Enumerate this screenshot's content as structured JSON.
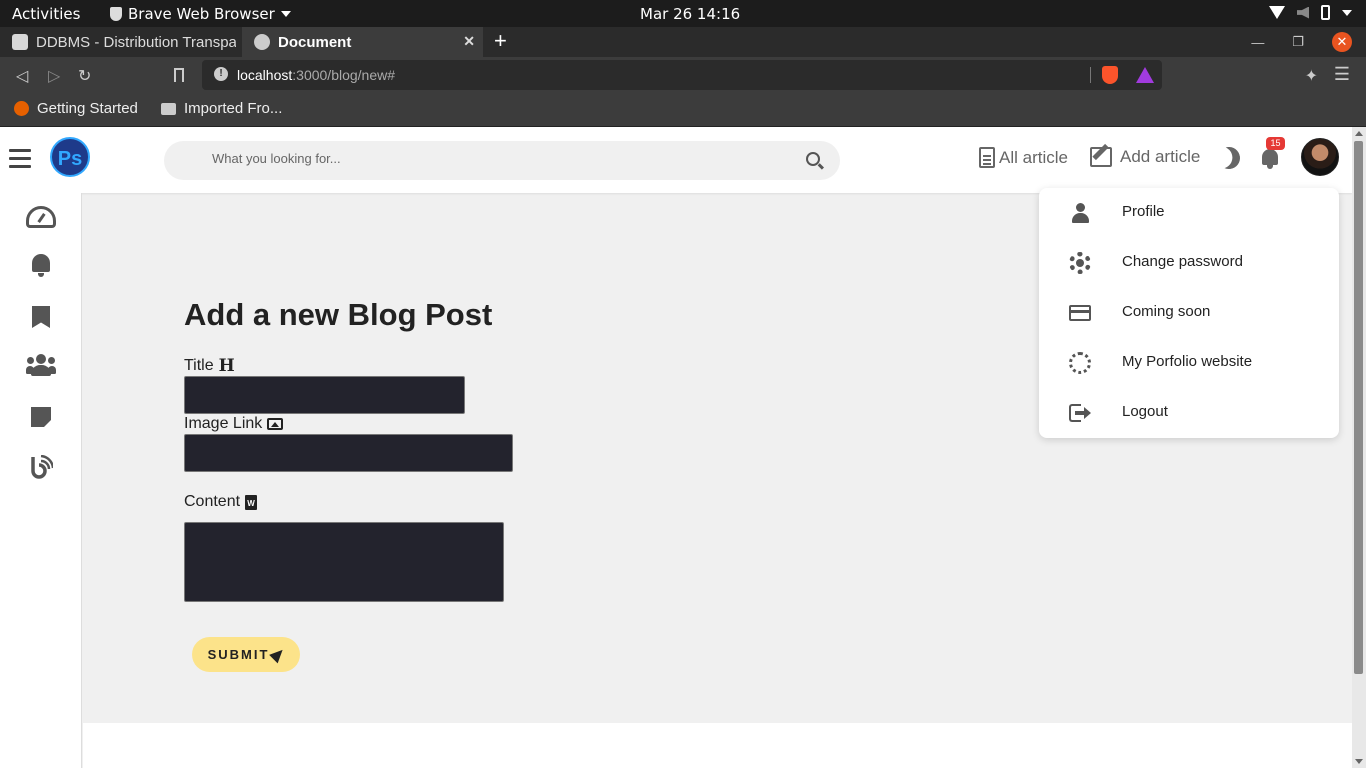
{
  "os": {
    "activities_label": "Activities",
    "app_name": "Brave Web Browser",
    "clock": "Mar 26  14:16"
  },
  "browser": {
    "tabs": [
      {
        "title": "DDBMS - Distribution Transpa",
        "active": false
      },
      {
        "title": "Document",
        "active": true
      }
    ],
    "url_host": "localhost",
    "url_rest": ":3000/blog/new#",
    "bookmarks": [
      {
        "label": "Getting Started",
        "icon": "firefox-icon"
      },
      {
        "label": "Imported Fro...",
        "icon": "folder-icon"
      }
    ]
  },
  "header": {
    "logo_text": "Ps",
    "search_placeholder": "What you looking for...",
    "nav": {
      "all_article": "All article",
      "add_article": "Add article"
    },
    "notification_count": "15"
  },
  "sidebar": {
    "items": [
      "dashboard-icon",
      "notifications-icon",
      "bookmark-icon",
      "users-icon",
      "notes-icon",
      "blog-icon"
    ]
  },
  "form": {
    "heading": "Add a new Blog Post",
    "title_label": "Title",
    "image_label": "Image Link",
    "content_label": "Content",
    "submit_label": "SUBMIT"
  },
  "dropdown": {
    "items": [
      {
        "label": "Profile",
        "icon": "person-icon"
      },
      {
        "label": "Change password",
        "icon": "gear-icon"
      },
      {
        "label": "Coming soon",
        "icon": "credit-card-icon"
      },
      {
        "label": "My Porfolio website",
        "icon": "spinner-icon"
      },
      {
        "label": "Logout",
        "icon": "logout-icon"
      }
    ]
  },
  "colors": {
    "accent_submit": "#fce38a",
    "field_bg": "#23232d",
    "badge": "#e53935",
    "window_close": "#e95420"
  }
}
